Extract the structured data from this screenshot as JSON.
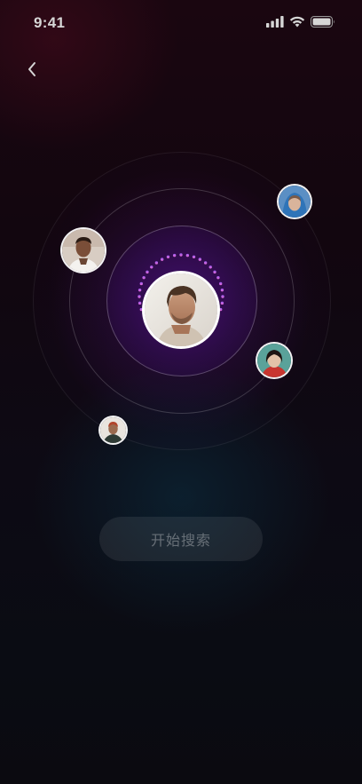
{
  "status_bar": {
    "time": "9:41",
    "icons": [
      "signal-icon",
      "wifi-icon",
      "battery-icon"
    ]
  },
  "nav": {
    "back_icon": "chevron-left-icon"
  },
  "radar": {
    "rings": 3,
    "ring_color": "#ffffff",
    "accent_gradient": [
      "#e66bd8",
      "#9a5cf0"
    ],
    "center_glow": "#4a1480",
    "avatars": [
      {
        "id": "center",
        "role": "current-user"
      },
      {
        "id": "top-right",
        "role": "nearby-user"
      },
      {
        "id": "left",
        "role": "nearby-user"
      },
      {
        "id": "right",
        "role": "nearby-user"
      },
      {
        "id": "bottom-left",
        "role": "nearby-user"
      }
    ]
  },
  "actions": {
    "start_search_label": "开始搜索"
  },
  "colors": {
    "background_top": "#1a0610",
    "background_bottom": "#0b0a10",
    "button_bg": "rgba(255,255,255,0.08)",
    "button_text": "rgba(255,255,255,0.32)"
  }
}
